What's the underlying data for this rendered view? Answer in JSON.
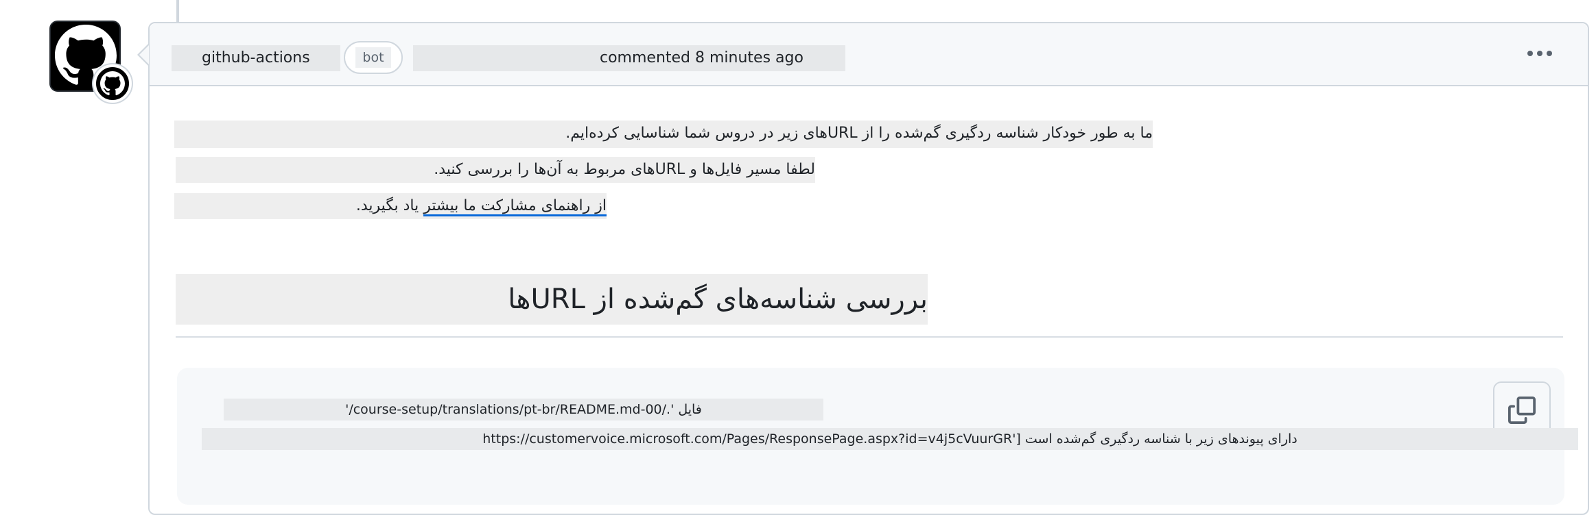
{
  "comment": {
    "author": "github-actions",
    "bot_label": "bot",
    "timestamp": "commented 8 minutes ago",
    "body": {
      "line1": "ما به طور خودکار شناسه ردگیری گم‌شده را از URLهای زیر در دروس شما شناسایی کرده‌ایم.",
      "line2": "لطفا مسیر فایل‌ها و URLهای مربوط به آن‌ها را بررسی کنید.",
      "line3_link": "از راهنمای مشارکت ما بیشتر",
      "line3_rest": " یاد بگیرید.",
      "heading": "بررسی شناسه‌های گم‌شده از URLها",
      "code_line1": "فایل './course-setup/translations/pt-br/README.md-00/'",
      "code_line2": "دارای پیوندهای زیر با شناسه ردگیری گم‌شده است ['https://customervoice.microsoft.com/Pages/ResponsePage.aspx?id=v4j5cVuurGR"
    }
  },
  "colors": {
    "link_underline": "#0969da",
    "border": "#d0d7de",
    "header_bg": "#f6f8fa"
  },
  "icons": {
    "avatar": "github-mark-icon",
    "badge": "github-mark-icon",
    "menu": "kebab-horizontal-icon",
    "copy": "copy-icon"
  }
}
